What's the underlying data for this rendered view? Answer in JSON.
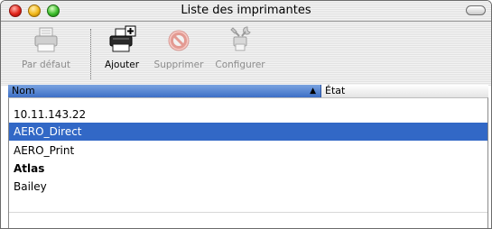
{
  "window": {
    "title": "Liste des imprimantes"
  },
  "toolbar": {
    "items": [
      {
        "label": "Par défaut",
        "icon": "printer-default-icon",
        "enabled": false
      },
      {
        "label": "Ajouter",
        "icon": "printer-add-icon",
        "enabled": true
      },
      {
        "label": "Supprimer",
        "icon": "delete-icon",
        "enabled": false
      },
      {
        "label": "Configurer",
        "icon": "configure-tools-icon",
        "enabled": false
      }
    ]
  },
  "columns": {
    "name": "Nom",
    "status": "État",
    "sort": "ascending"
  },
  "printers": [
    {
      "name": "10.11.143.22",
      "selected": false,
      "bold": false
    },
    {
      "name": "AERO_Direct",
      "selected": true,
      "bold": false
    },
    {
      "name": "AERO_Print",
      "selected": false,
      "bold": false
    },
    {
      "name": "Atlas",
      "selected": false,
      "bold": true
    },
    {
      "name": "Bailey",
      "selected": false,
      "bold": false
    }
  ],
  "colors": {
    "selection": "#3268c6",
    "header_active": "#5a87d6"
  }
}
